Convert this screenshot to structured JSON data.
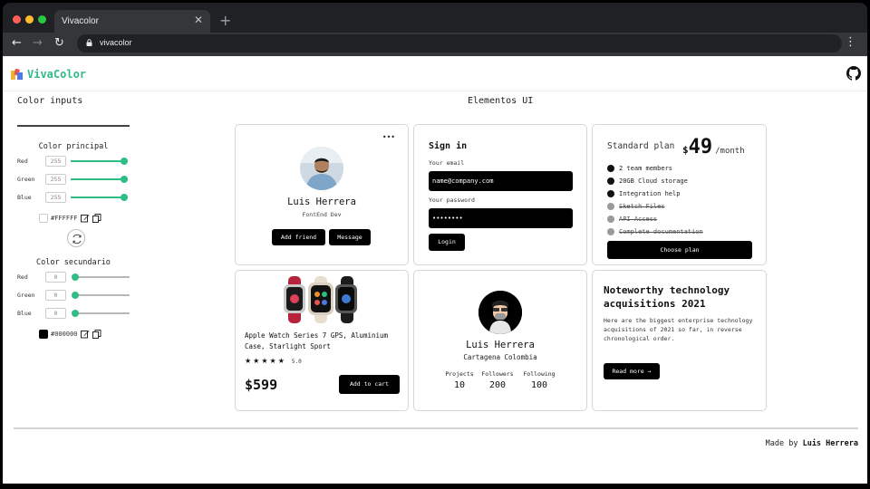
{
  "browser": {
    "tab_title": "Vivacolor",
    "tab_close": "✕",
    "new_tab": "+",
    "back": "←",
    "forward": "→",
    "reload": "↻",
    "url": "vivacolor",
    "menu": "⋮"
  },
  "app": {
    "brand": "VivaColor",
    "left_title": "Color inputs",
    "center_title": "Elementos UI"
  },
  "primary": {
    "title": "Color principal",
    "channels": [
      {
        "label": "Red",
        "value": "255",
        "level": 1.0
      },
      {
        "label": "Green",
        "value": "255",
        "level": 1.0
      },
      {
        "label": "Blue",
        "value": "255",
        "level": 1.0
      }
    ],
    "hex": "#FFFFFF",
    "swatch": "#ffffff"
  },
  "secondary": {
    "title": "Color secundario",
    "channels": [
      {
        "label": "Red",
        "value": "0",
        "level": 0.0
      },
      {
        "label": "Green",
        "value": "0",
        "level": 0.0
      },
      {
        "label": "Blue",
        "value": "0",
        "level": 0.0
      }
    ],
    "hex": "#000000",
    "swatch": "#000000"
  },
  "profile_card": {
    "menu": "•••",
    "name": "Luis Herrera",
    "role": "FontEnd Dev",
    "add_friend": "Add friend",
    "message": "Message"
  },
  "signin": {
    "title": "Sign in",
    "email_label": "Your email",
    "email_value": "name@company.com",
    "password_label": "Your password",
    "password_value": "••••••••",
    "login": "Login"
  },
  "plan": {
    "name": "Standard plan",
    "currency": "$",
    "price": "49",
    "period": "/month",
    "features": [
      {
        "text": "2 team members",
        "included": true
      },
      {
        "text": "20GB Cloud storage",
        "included": true
      },
      {
        "text": "Integration help",
        "included": true
      },
      {
        "text": "Sketch Files",
        "included": false
      },
      {
        "text": "API Access",
        "included": false
      },
      {
        "text": "Complete documentation",
        "included": false
      }
    ],
    "cta": "Choose plan"
  },
  "product": {
    "title": "Apple Watch Series 7 GPS, Aluminium Case, Starlight Sport",
    "stars": 5,
    "rating": "5.0",
    "price": "$599",
    "cta": "Add to cart"
  },
  "stats_card": {
    "name": "Luis Herrera",
    "location": "Cartagena Colombia",
    "stats": [
      {
        "label": "Projects",
        "value": "10"
      },
      {
        "label": "Followers",
        "value": "200"
      },
      {
        "label": "Following",
        "value": "100"
      }
    ]
  },
  "article": {
    "title": "Noteworthy technology acquisitions 2021",
    "body": "Here are the biggest enterprise technology acquisitions of 2021 so far, in reverse chronological order.",
    "cta": "Read more →"
  },
  "footer": {
    "prefix": "Made by",
    "author": "Luis Herrera"
  },
  "colors": {
    "accent": "#2ebd84",
    "dark": "#000000",
    "chrome_dark": "#202124"
  }
}
